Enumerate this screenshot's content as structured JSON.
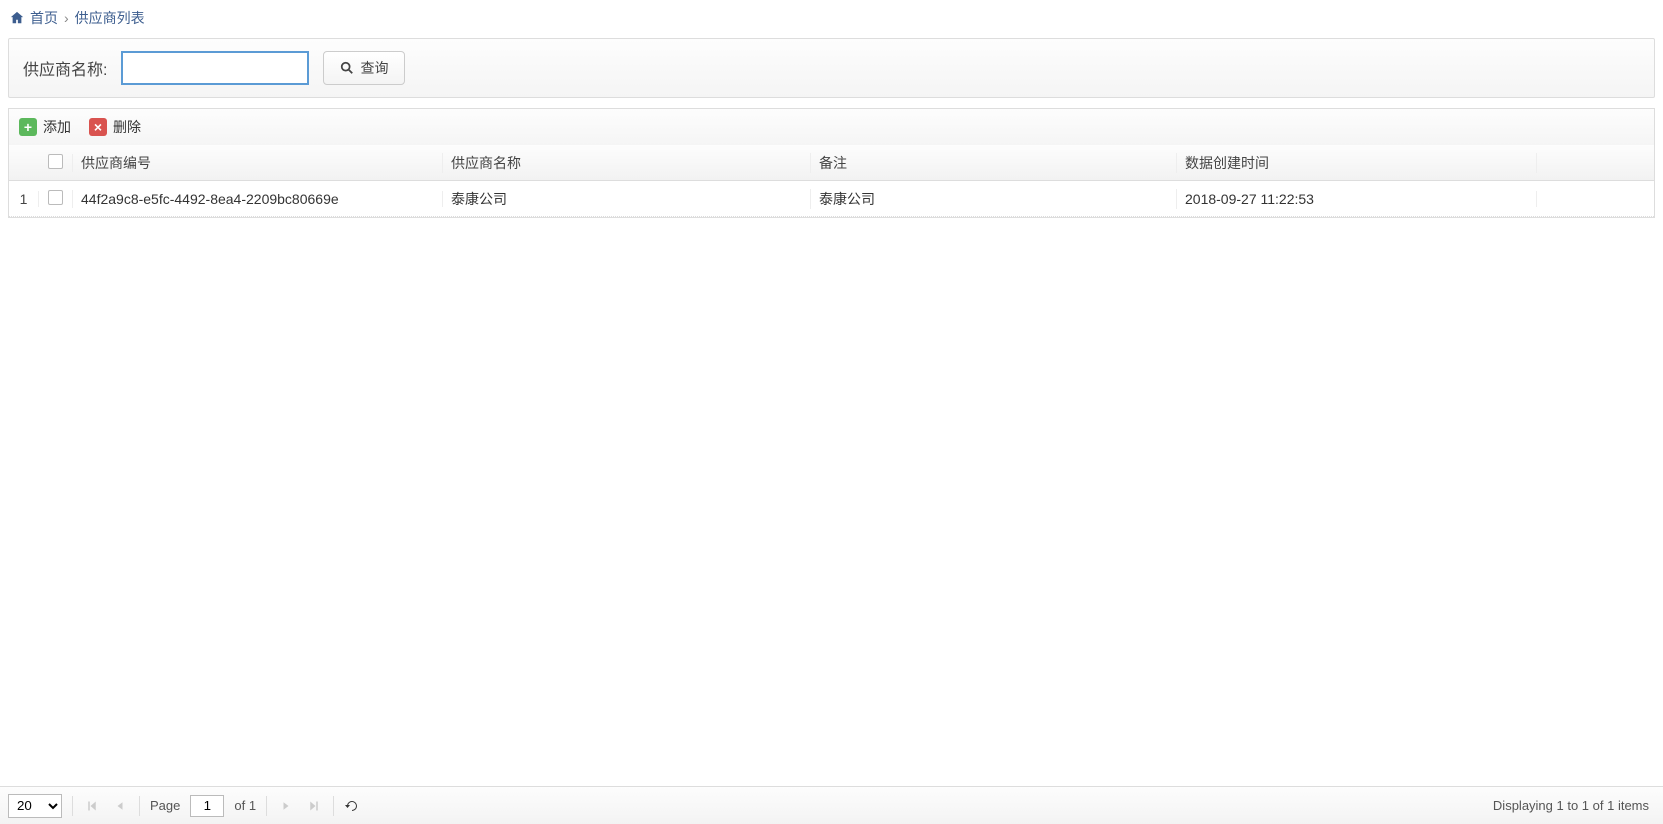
{
  "breadcrumb": {
    "home": "首页",
    "current": "供应商列表"
  },
  "search": {
    "label": "供应商名称:",
    "value": "",
    "query_btn": "查询"
  },
  "toolbar": {
    "add": "添加",
    "delete": "删除"
  },
  "grid": {
    "headers": {
      "code": "供应商编号",
      "name": "供应商名称",
      "remark": "备注",
      "time": "数据创建时间"
    },
    "rows": [
      {
        "num": "1",
        "code": "44f2a9c8-e5fc-4492-8ea4-2209bc80669e",
        "name": "泰康公司",
        "remark": "泰康公司",
        "time": "2018-09-27 11:22:53"
      }
    ]
  },
  "pager": {
    "page_size": "20",
    "page_label": "Page",
    "page": "1",
    "of_label": "of 1",
    "info": "Displaying 1 to 1 of 1 items"
  }
}
